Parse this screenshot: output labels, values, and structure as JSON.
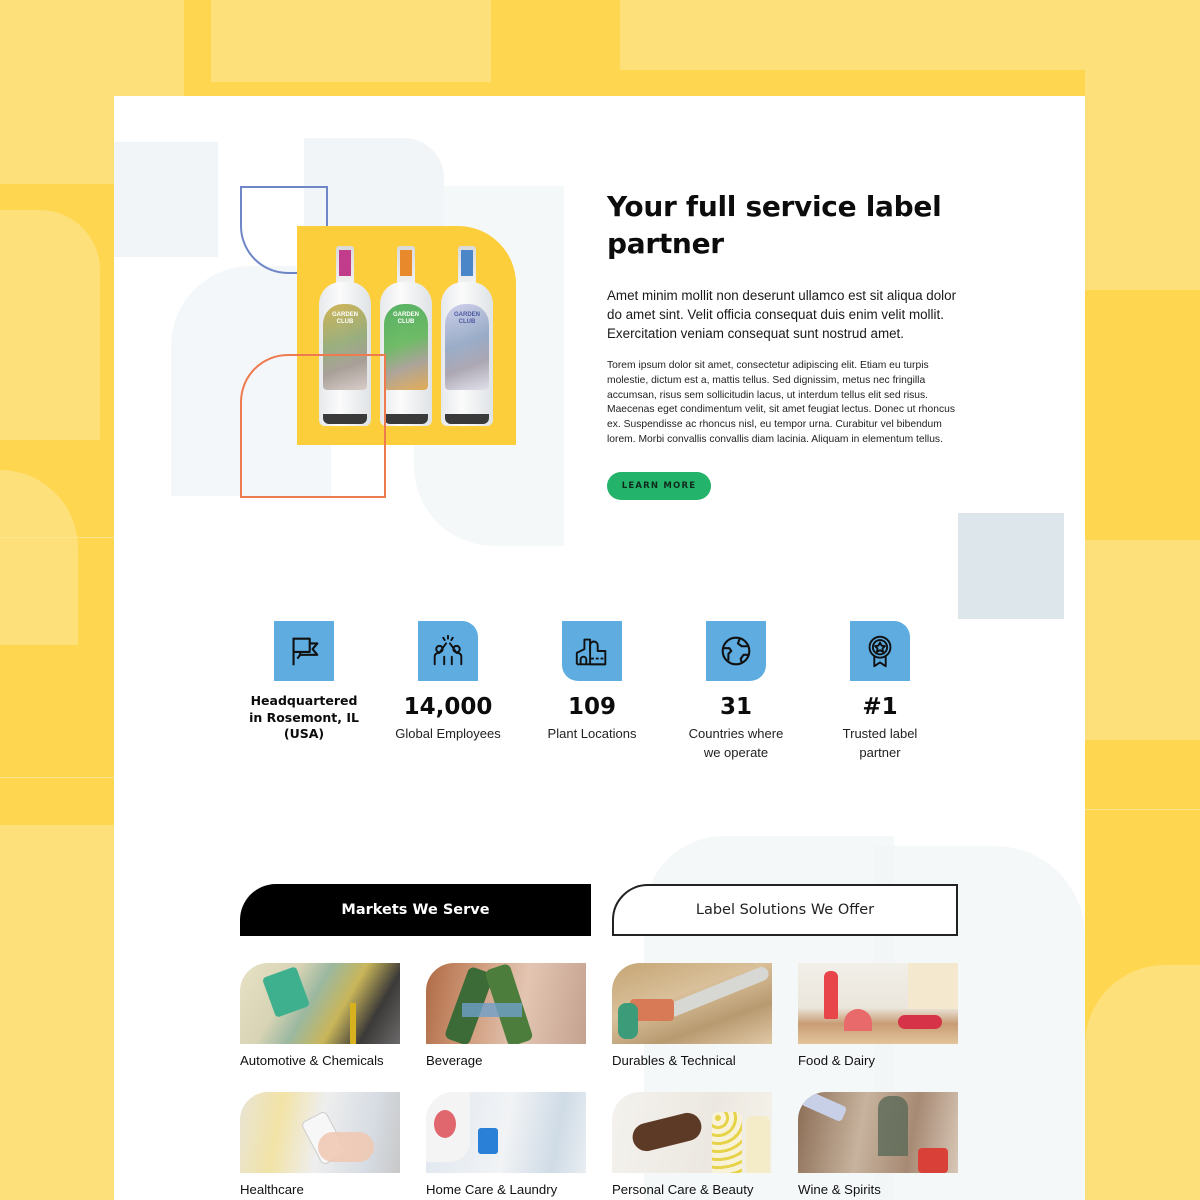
{
  "colors": {
    "page_bg": "#ffd64f",
    "accent_green": "#23b36b",
    "icon_tile_blue": "#5eace0",
    "photo_bg_yellow": "#fdce3c",
    "frame_blue": "#6f86c6",
    "frame_orange": "#ee7b4f"
  },
  "hero": {
    "image": {
      "description": "Three Garden Club gin bottles on a yellow background",
      "bottles": [
        {
          "brand": "GARDEN CLUB",
          "accent": "#c13c8a"
        },
        {
          "brand": "GARDEN CLUB",
          "accent": "#e88a2c"
        },
        {
          "brand": "GARDEN CLUB",
          "accent": "#4b86c9"
        }
      ]
    },
    "title": "Your full service label partner",
    "lead": "Amet minim mollit non deserunt ullamco est sit aliqua dolor do amet sint. Velit officia consequat duis enim velit mollit. Exercitation veniam consequat sunt nostrud amet.",
    "body": "Torem ipsum dolor sit amet, consectetur adipiscing elit. Etiam eu turpis molestie, dictum est a, mattis tellus. Sed dignissim, metus nec fringilla accumsan, risus sem sollicitudin lacus, ut interdum tellus elit sed risus. Maecenas eget condimentum velit, sit amet feugiat lectus. Donec ut rhoncus ex. Suspendisse ac rhoncus nisl, eu tempor urna. Curabitur vel bibendum lorem. Morbi convallis convallis diam lacinia. Aliquam in elementum tellus.",
    "cta_label": "LEARN MORE"
  },
  "stats": [
    {
      "icon": "flag-icon",
      "heading": "Headquartered in Rosemont, IL (USA)",
      "number": "",
      "label": ""
    },
    {
      "icon": "people-high-five-icon",
      "heading": "",
      "number": "14,000",
      "label": "Global Employees"
    },
    {
      "icon": "factory-icon",
      "heading": "",
      "number": "109",
      "label": "Plant Locations"
    },
    {
      "icon": "globe-icon",
      "heading": "",
      "number": "31",
      "label": "Countries where we operate"
    },
    {
      "icon": "award-star-icon",
      "heading": "",
      "number": "#1",
      "label": "Trusted label partner"
    }
  ],
  "tabs": [
    {
      "label": "Markets We Serve",
      "active": true
    },
    {
      "label": "Label Solutions We Offer",
      "active": false
    }
  ],
  "markets": [
    {
      "label": "Automotive & Chemicals",
      "image": "motor oil being poured from labeled jug"
    },
    {
      "label": "Beverage",
      "image": "green beer bottles clinking"
    },
    {
      "label": "Durables & Technical",
      "image": "chainsaw with labeled housing"
    },
    {
      "label": "Food & Dairy",
      "image": "strawberry yogurt drink and fresh fruit"
    },
    {
      "label": "Healthcare",
      "image": "hand holding labeled medicine bottle in pharmacy"
    },
    {
      "label": "Home Care &  Laundry",
      "image": "detergent being poured into blue cap"
    },
    {
      "label": "Personal Care & Beauty",
      "image": "hands using pump lotion bottles"
    },
    {
      "label": "Wine & Spirits",
      "image": "wine being poured at dinner table"
    }
  ]
}
